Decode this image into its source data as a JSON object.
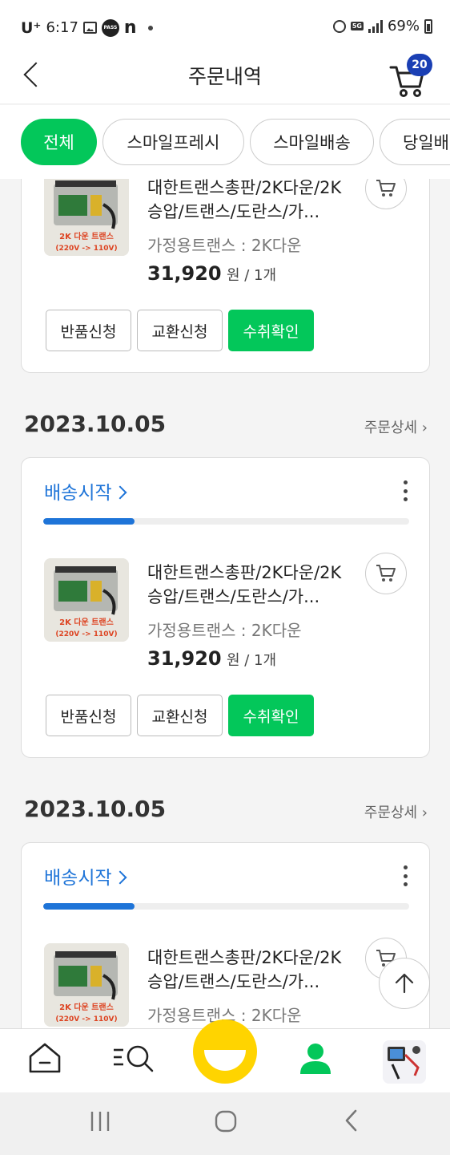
{
  "status_bar": {
    "carrier": "U⁺",
    "time": "6:17",
    "pass_label": "PASS",
    "n_label": "n",
    "network": "5G",
    "battery": "69%"
  },
  "header": {
    "title": "주문내역",
    "cart_count": "20"
  },
  "tabs": [
    {
      "label": "전체",
      "active": true
    },
    {
      "label": "스마일프레시"
    },
    {
      "label": "스마일배송"
    },
    {
      "label": "당일배"
    }
  ],
  "orders": [
    {
      "product": {
        "name": "대한트랜스총판/2K다운/2K승압/트랜스/도란스/가...",
        "option": "가정용트랜스 : 2K다운",
        "price": "31,920",
        "price_unit": "원 / 1개",
        "image_text": "2K 다운 트랜스",
        "image_subtext": "(220V -> 110V)"
      },
      "buttons": {
        "return": "반품신청",
        "exchange": "교환신청",
        "confirm": "수취확인"
      }
    },
    {
      "date": "2023.10.05",
      "detail_link": "주문상세 ›",
      "status": "배송시작",
      "progress": 0.25,
      "product": {
        "name": "대한트랜스총판/2K다운/2K승압/트랜스/도란스/가...",
        "option": "가정용트랜스 : 2K다운",
        "price": "31,920",
        "price_unit": "원 / 1개",
        "image_text": "2K 다운 트랜스",
        "image_subtext": "(220V -> 110V)"
      },
      "buttons": {
        "return": "반품신청",
        "exchange": "교환신청",
        "confirm": "수취확인"
      }
    },
    {
      "date": "2023.10.05",
      "detail_link": "주문상세 ›",
      "status": "배송시작",
      "progress": 0.25,
      "product": {
        "name": "대한트랜스총판/2K다운/2K승압/트랜스/도란스/가...",
        "option": "가정용트랜스 : 2K다운",
        "image_text": "2K 다운 트랜스",
        "image_subtext": "(220V -> 110V)"
      }
    }
  ],
  "colors": {
    "brand_green": "#03c75a",
    "status_blue": "#1e74d8",
    "badge_blue": "#1a3fb4",
    "smile_yellow": "#ffd400"
  },
  "bottom_nav": [
    "home-icon",
    "category-search-icon",
    "smile-icon",
    "my-page-icon",
    "recent-product-thumbnail"
  ],
  "system_nav": [
    "recent-apps-icon",
    "home-circle-icon",
    "back-icon"
  ]
}
